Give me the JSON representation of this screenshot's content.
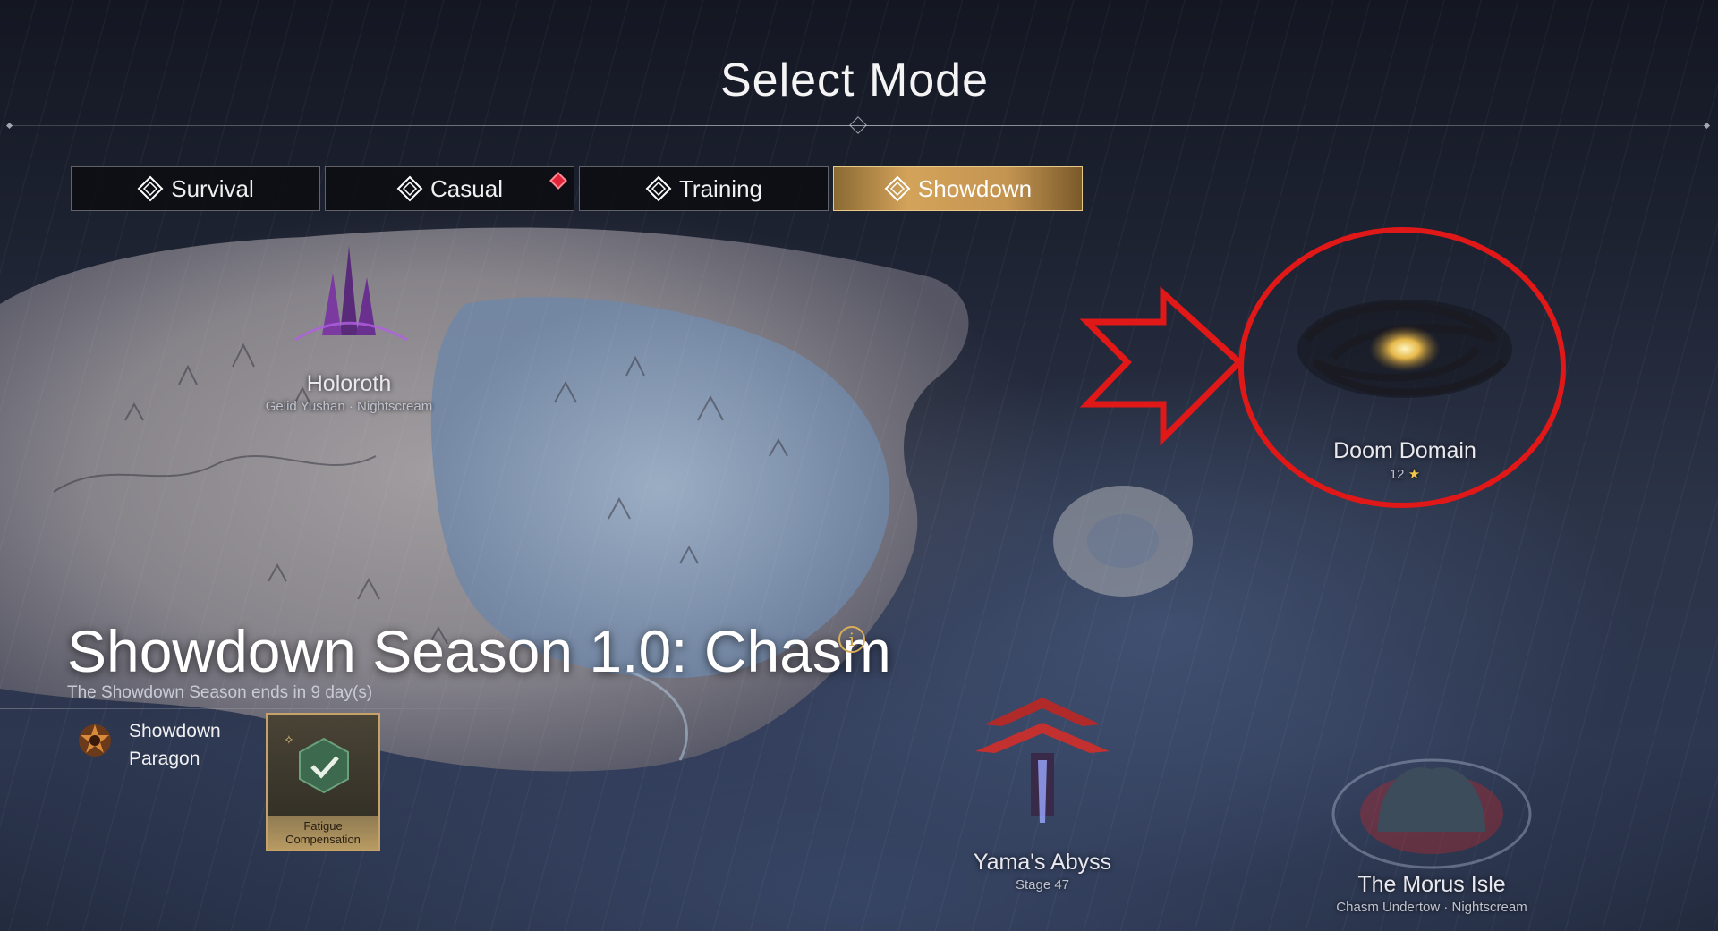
{
  "header": {
    "title": "Select Mode"
  },
  "tabs": [
    {
      "label": "Survival",
      "active": false,
      "alert": false
    },
    {
      "label": "Casual",
      "active": false,
      "alert": true
    },
    {
      "label": "Training",
      "active": false,
      "alert": false
    },
    {
      "label": "Showdown",
      "active": true,
      "alert": false
    }
  ],
  "map": {
    "locations": {
      "holoroth": {
        "name": "Holoroth",
        "sub": "Gelid Yushan · Nightscream"
      },
      "doom_domain": {
        "name": "Doom Domain",
        "stars": "12"
      },
      "yamas_abyss": {
        "name": "Yama's Abyss",
        "sub": "Stage 47"
      },
      "morus_isle": {
        "name": "The Morus Isle",
        "sub": "Chasm Undertow · Nightscream"
      }
    }
  },
  "season": {
    "title": "Showdown Season 1.0: Chasm",
    "ends_text": "The Showdown Season ends in 9 day(s)",
    "paragon_label": "Showdown Paragon",
    "fatigue_label": "Fatigue Compensation"
  },
  "colors": {
    "active_tab": "#d4a35a",
    "annotation": "#e01818",
    "alert": "#e0243a"
  }
}
